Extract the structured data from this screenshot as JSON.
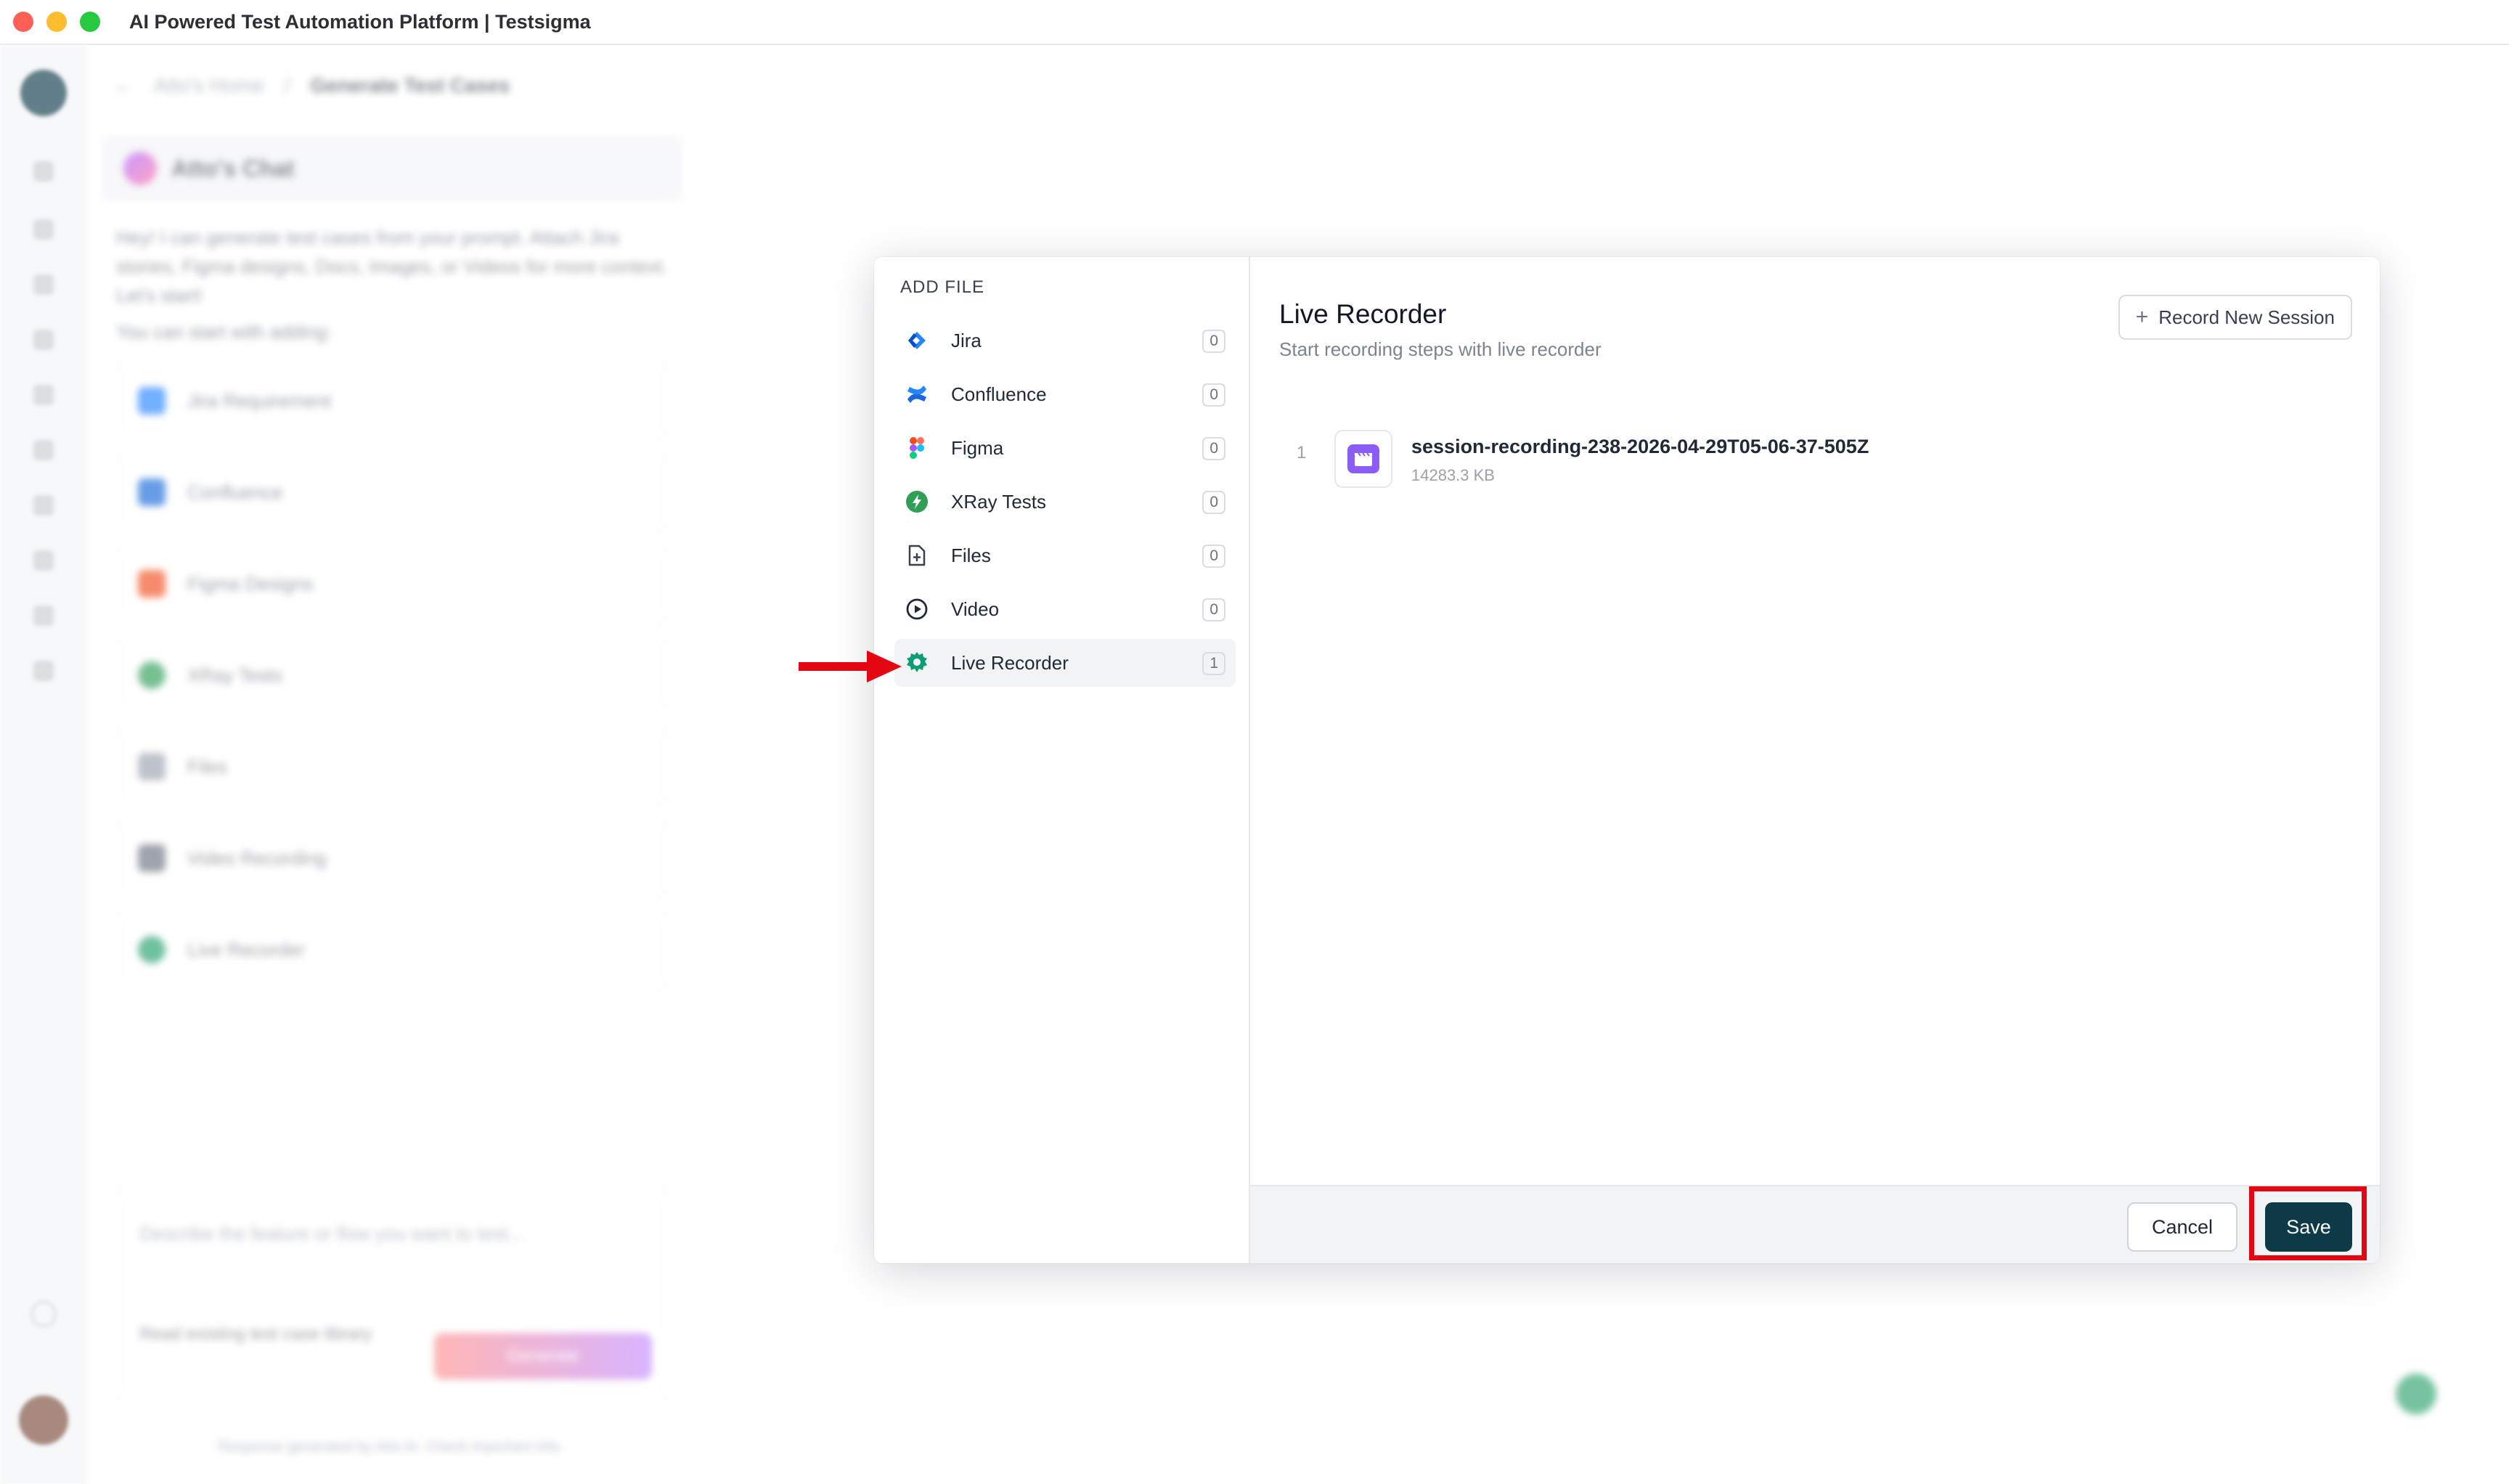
{
  "window": {
    "title": "AI Powered Test Automation Platform | Testsigma"
  },
  "background": {
    "breadcrumb": [
      "Atto's Home",
      "Generate Test Cases"
    ],
    "chat_title": "Atto's Chat",
    "chat_intro": "Hey! I can generate test cases from your prompt. Attach Jira stories, Figma designs, Docs, Images, or Videos for more context. Let's start!",
    "chat_start": "You can start with adding:",
    "sources": [
      "Jira Requirement",
      "Confluence",
      "Figma Designs",
      "XRay Tests",
      "Files",
      "Video Recording",
      "Live Recorder"
    ],
    "prompt_placeholder": "Describe the feature or flow you want to test...",
    "checkbox_label": "Read existing test case library",
    "generate_label": "Generate",
    "disclaimer": "Response generated by Atto AI. Check important info."
  },
  "modal": {
    "side_title": "ADD FILE",
    "sources": [
      {
        "label": "Jira",
        "count": "0",
        "icon": "jira-icon"
      },
      {
        "label": "Confluence",
        "count": "0",
        "icon": "confluence-icon"
      },
      {
        "label": "Figma",
        "count": "0",
        "icon": "figma-icon"
      },
      {
        "label": "XRay Tests",
        "count": "0",
        "icon": "xray-icon"
      },
      {
        "label": "Files",
        "count": "0",
        "icon": "file-icon"
      },
      {
        "label": "Video",
        "count": "0",
        "icon": "play-circle-icon"
      },
      {
        "label": "Live Recorder",
        "count": "1",
        "icon": "live-recorder-icon",
        "active": true
      }
    ],
    "main": {
      "title": "Live Recorder",
      "subtitle": "Start recording steps with live recorder",
      "record_button": "Record New Session",
      "recordings": [
        {
          "index": "1",
          "name": "session-recording-238-2026-04-29T05-06-37-505Z",
          "size": "14283.3 KB"
        }
      ]
    },
    "footer": {
      "cancel": "Cancel",
      "save": "Save"
    }
  },
  "colors": {
    "primary": "#0d3a47",
    "highlight": "#e30613",
    "active_bg": "#f1f3f5",
    "recording_thumb": "#8b5cf6"
  }
}
